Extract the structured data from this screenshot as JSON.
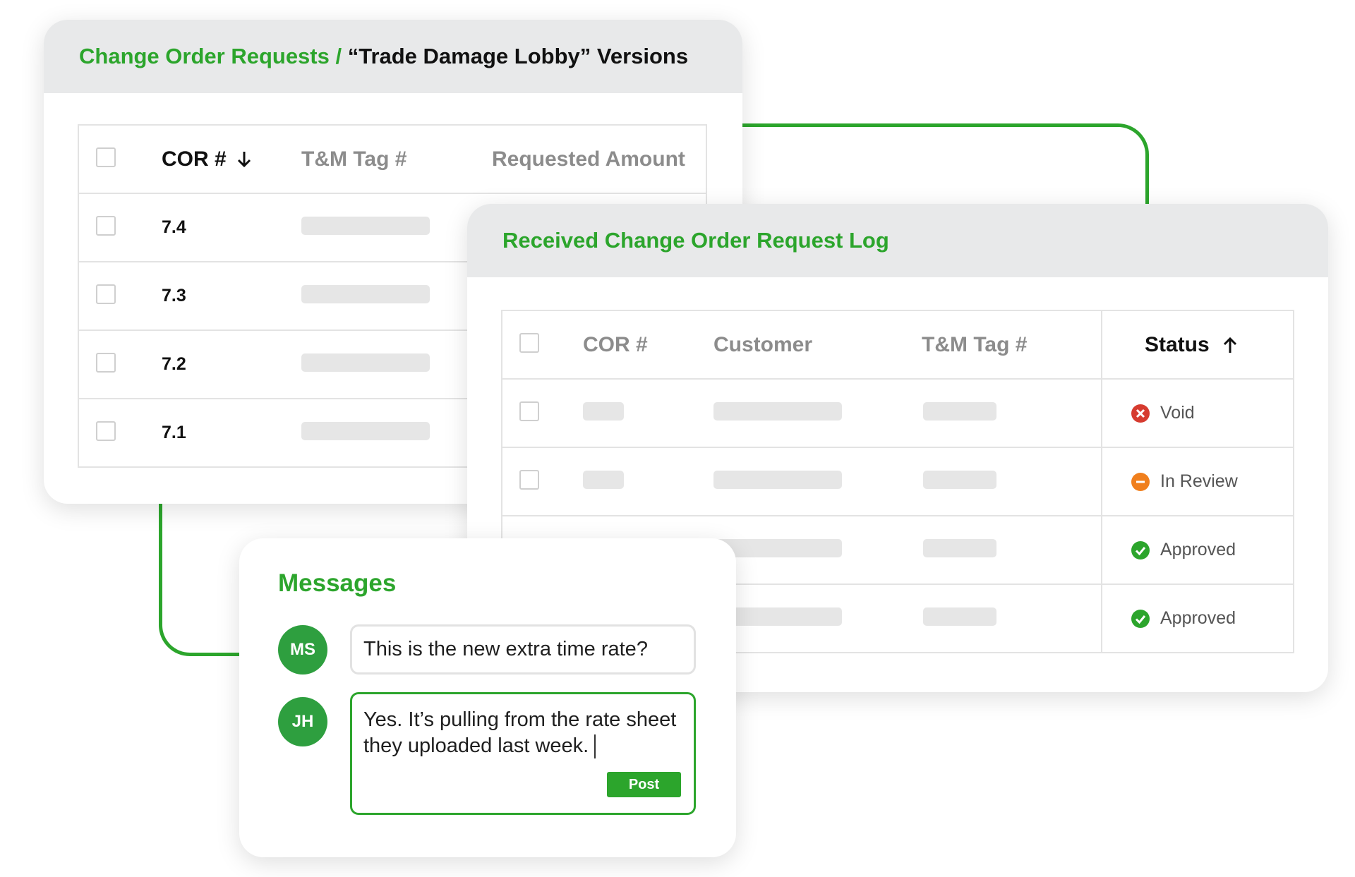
{
  "card1": {
    "title_link": "Change Order Requests",
    "title_sep": " / ",
    "title_rest": "“Trade Damage Lobby” Versions",
    "columns": [
      "COR #",
      "T&M Tag #",
      "Requested Amount"
    ],
    "sort_icon": "arrow-down-icon",
    "rows": [
      {
        "cor": "7.4"
      },
      {
        "cor": "7.3"
      },
      {
        "cor": "7.2"
      },
      {
        "cor": "7.1"
      }
    ]
  },
  "card2": {
    "title": "Received Change Order Request Log",
    "columns": [
      "COR #",
      "Customer",
      "T&M Tag #",
      "Status"
    ],
    "sort_icon": "arrow-up-icon",
    "rows": [
      {
        "status": "Void",
        "icon": "x-circle-icon",
        "color": "#d63b2f"
      },
      {
        "status": "In Review",
        "icon": "minus-circle-icon",
        "color": "#f07f1d"
      },
      {
        "status": "Approved",
        "icon": "check-circle-icon",
        "color": "#2ca52c"
      },
      {
        "status": "Approved",
        "icon": "check-circle-icon",
        "color": "#2ca52c"
      }
    ]
  },
  "messages": {
    "title": "Messages",
    "items": [
      {
        "initials": "MS",
        "text": "This is the new extra time rate?"
      },
      {
        "initials": "JH",
        "text": "Yes. It’s pulling from the rate sheet they uploaded last week."
      }
    ],
    "post_label": "Post"
  },
  "colors": {
    "accent": "#2ca52c",
    "header_bg": "#e8e9ea",
    "avatar": "#2e9f3f"
  }
}
